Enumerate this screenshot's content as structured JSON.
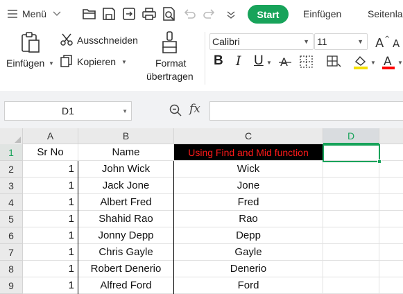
{
  "menubar": {
    "menu_label": "Menü",
    "start_tab": "Start",
    "tabs": [
      "Einfügen",
      "Seitenla"
    ],
    "accent_color": "#17a35a"
  },
  "ribbon": {
    "paste_label": "Einfügen",
    "cut_label": "Ausschneiden",
    "copy_label": "Kopieren",
    "format_painter_line1": "Format",
    "format_painter_line2": "übertragen",
    "font_name": "Calibri",
    "font_size": "11",
    "bold": "B",
    "italic": "I",
    "underline": "U",
    "font_color": "A",
    "font_color_value": "#ff0000",
    "highlight_color_value": "#f5e000"
  },
  "formula_bar": {
    "name_box": "D1",
    "fx_label": "fx",
    "formula_value": ""
  },
  "grid": {
    "column_headers": [
      "A",
      "B",
      "C",
      "D"
    ],
    "selected_cell": "D1",
    "rows": [
      {
        "num": "1",
        "a": "Sr No",
        "b": "Name",
        "c": "Using Find and Mid function"
      },
      {
        "num": "2",
        "a": "1",
        "b": "John Wick",
        "c": "Wick"
      },
      {
        "num": "3",
        "a": "1",
        "b": "Jack Jone",
        "c": "Jone"
      },
      {
        "num": "4",
        "a": "1",
        "b": "Albert Fred",
        "c": "Fred"
      },
      {
        "num": "5",
        "a": "1",
        "b": "Shahid Rao",
        "c": "Rao"
      },
      {
        "num": "6",
        "a": "1",
        "b": "Jonny Depp",
        "c": "Depp"
      },
      {
        "num": "7",
        "a": "1",
        "b": "Chris Gayle",
        "c": "Gayle"
      },
      {
        "num": "8",
        "a": "1",
        "b": "Robert Denerio",
        "c": "Denerio"
      },
      {
        "num": "9",
        "a": "1",
        "b": "Alfred Ford",
        "c": "Ford"
      }
    ]
  }
}
